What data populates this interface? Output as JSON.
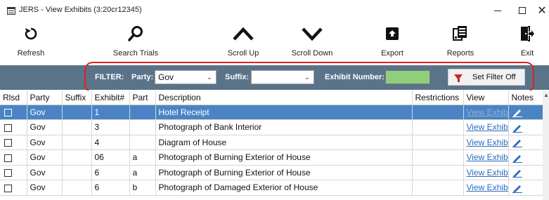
{
  "window": {
    "title": "JERS - View Exhibits (3:20cr12345)",
    "minimize_label": "–",
    "close_label": "✕"
  },
  "toolbar": {
    "refresh": "Refresh",
    "search": "Search Trials",
    "scroll_up": "Scroll Up",
    "scroll_down": "Scroll Down",
    "export": "Export",
    "reports": "Reports",
    "exit": "Exit"
  },
  "filter": {
    "title": "FILTER:",
    "party_label": "Party:",
    "party_value": "Gov",
    "suffix_label": "Suffix:",
    "suffix_value": "",
    "exhibit_number_label": "Exhibit Number:",
    "exhibit_number_value": "",
    "set_filter_off": "Set Filter Off"
  },
  "grid": {
    "columns": [
      "Rlsd",
      "Party",
      "Suffix",
      "Exhibit#",
      "Part",
      "Description",
      "Restrictions",
      "View",
      "Notes"
    ],
    "view_link_text": "View Exhibit",
    "rows": [
      {
        "party": "Gov",
        "suffix": "",
        "exhibit": "1",
        "part": "",
        "description": "Hotel Receipt",
        "restrictions": "",
        "selected": true
      },
      {
        "party": "Gov",
        "suffix": "",
        "exhibit": "3",
        "part": "",
        "description": "Photograph of Bank Interior",
        "restrictions": "",
        "selected": false
      },
      {
        "party": "Gov",
        "suffix": "",
        "exhibit": "4",
        "part": "",
        "description": "Diagram of House",
        "restrictions": "",
        "selected": false
      },
      {
        "party": "Gov",
        "suffix": "",
        "exhibit": "06",
        "part": "a",
        "description": "Photograph of Burning Exterior of House",
        "restrictions": "",
        "selected": false
      },
      {
        "party": "Gov",
        "suffix": "",
        "exhibit": "6",
        "part": "a",
        "description": "Photograph of Burning Exterior of House",
        "restrictions": "",
        "selected": false
      },
      {
        "party": "Gov",
        "suffix": "",
        "exhibit": "6",
        "part": "b",
        "description": "Photograph of Damaged Exterior of House",
        "restrictions": "",
        "selected": false
      }
    ]
  },
  "colors": {
    "filter_bar": "#5a7389",
    "selected_row": "#4a84c4",
    "exhibit_number_input": "#8fcf7c",
    "highlight_frame": "#e02020"
  }
}
